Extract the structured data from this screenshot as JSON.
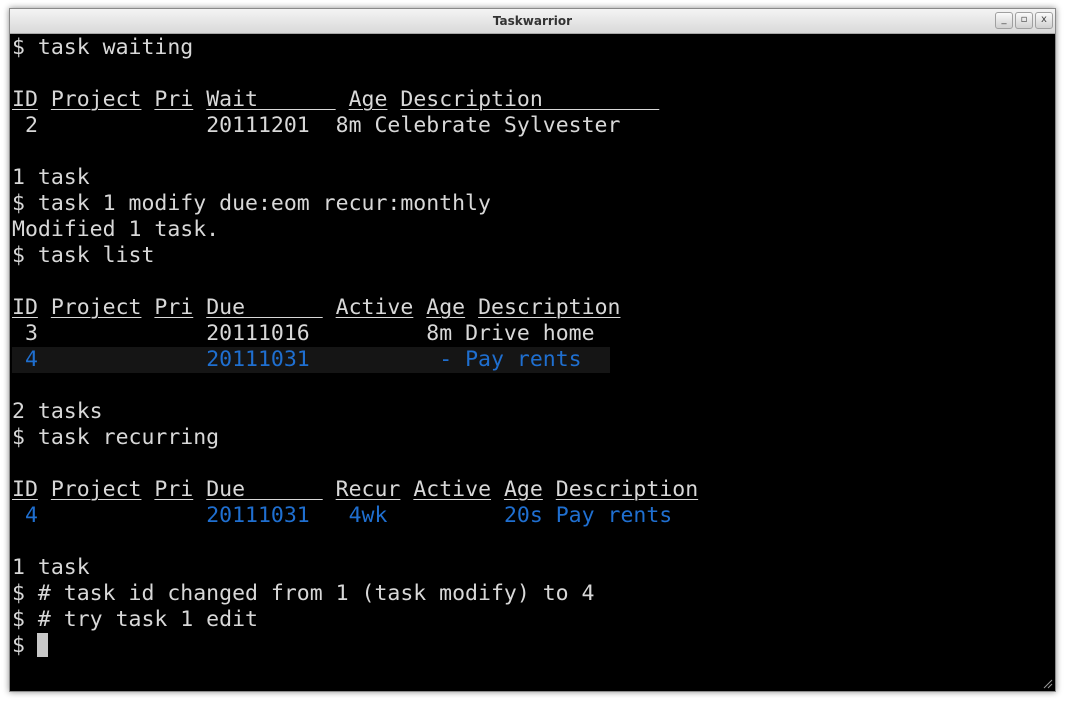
{
  "window": {
    "title": "Taskwarrior",
    "buttons": [
      "_",
      "▫",
      "x"
    ]
  },
  "terminal": {
    "prompt": "$",
    "cmd_waiting": "task waiting",
    "waiting_table": {
      "headers": [
        "ID",
        "Project",
        "Pri",
        "Wait      ",
        "Age",
        "Description         "
      ],
      "row": {
        "id": "2",
        "wait": "20111201",
        "age": "8m",
        "description": "Celebrate Sylvester"
      }
    },
    "waiting_count": "1 task",
    "cmd_modify": "task 1 modify due:eom recur:monthly",
    "modify_result": "Modified 1 task.",
    "cmd_list": "task list",
    "list_table": {
      "headers": [
        "ID",
        "Project",
        "Pri",
        "Due      ",
        "Active",
        "Age",
        "Description"
      ],
      "rows": [
        {
          "id": "3",
          "due": "20111016",
          "active": "",
          "age": "8m",
          "description": "Drive home"
        },
        {
          "id": "4",
          "due": "20111031",
          "active": "",
          "age": "-",
          "description": "Pay rents"
        }
      ]
    },
    "list_count": "2 tasks",
    "cmd_recurring": "task recurring",
    "recurring_table": {
      "headers": [
        "ID",
        "Project",
        "Pri",
        "Due      ",
        "Recur",
        "Active",
        "Age",
        "Description"
      ],
      "row": {
        "id": "4",
        "due": "20111031",
        "recur": "4wk",
        "active": "",
        "age": "20s",
        "description": "Pay rents"
      }
    },
    "recurring_count": "1 task",
    "comment1": "# task id changed from 1 (task modify) to 4",
    "comment2": "# try task 1 edit"
  },
  "colors": {
    "terminal_bg": "#000000",
    "text": "#d8d8d8",
    "highlight_blue": "#1f6fd0",
    "row_highlight": "#151515"
  }
}
